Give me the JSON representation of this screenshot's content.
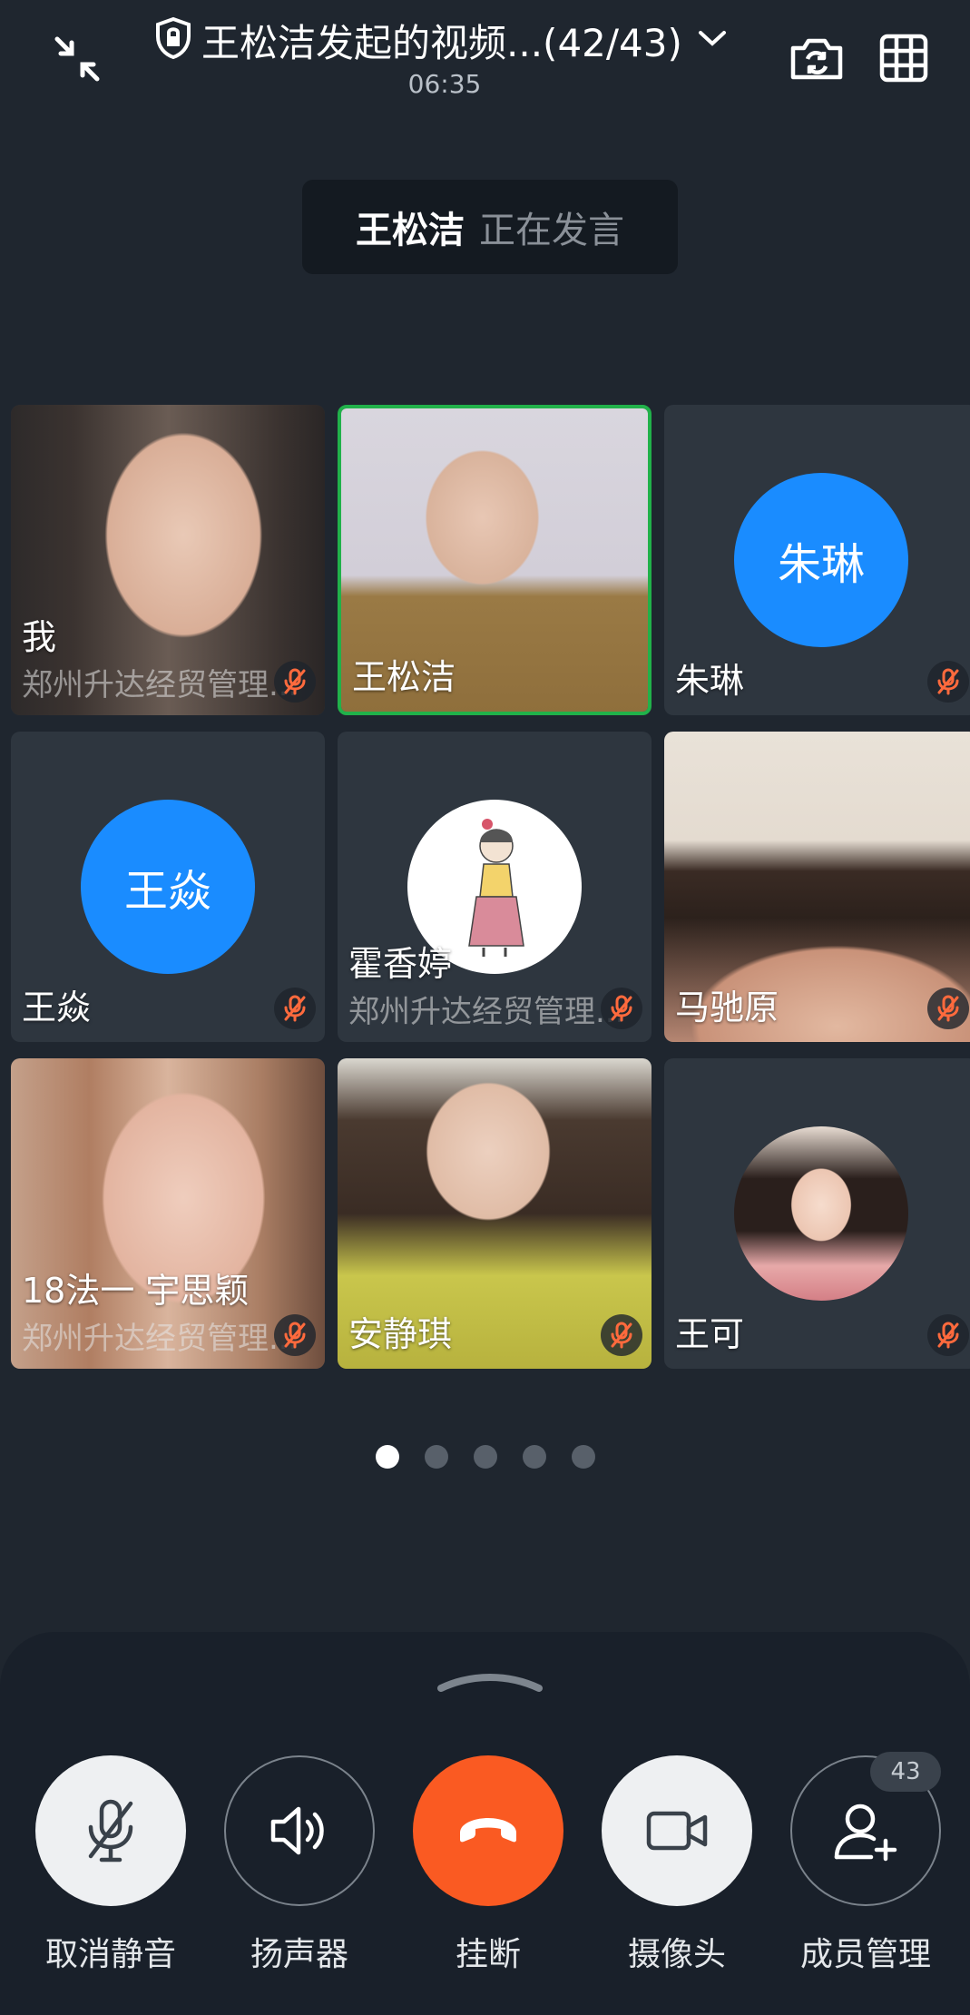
{
  "header": {
    "title": "王松洁发起的视频...(42/43)",
    "timer": "06:35"
  },
  "speaker": {
    "name": "王松洁",
    "status": "正在发言"
  },
  "participants": [
    {
      "name": "我",
      "org": "郑州升达经贸管理...",
      "muted": true
    },
    {
      "name": "王松洁",
      "org": "",
      "muted": false,
      "active": true
    },
    {
      "name": "朱琳",
      "avatar_text": "朱琳",
      "muted": true
    },
    {
      "name": "王焱",
      "avatar_text": "王焱",
      "muted": true
    },
    {
      "name": "霍香婷",
      "org": "郑州升达经贸管理...",
      "muted": true
    },
    {
      "name": "马驰原",
      "muted": true
    },
    {
      "name": "18法一 宇思颖",
      "org": "郑州升达经贸管理...",
      "muted": true
    },
    {
      "name": "安静琪",
      "muted": true
    },
    {
      "name": "王可",
      "muted": true
    }
  ],
  "pagination": {
    "pages": 5,
    "current": 1
  },
  "controls": {
    "unmute": "取消静音",
    "speaker": "扬声器",
    "hangup": "挂断",
    "camera": "摄像头",
    "members": "成员管理",
    "member_count": "43"
  },
  "colors": {
    "background": "#1f262f",
    "accent_blue": "#1a8cff",
    "active_border": "#21b14a",
    "hangup_red": "#fa5a22"
  }
}
